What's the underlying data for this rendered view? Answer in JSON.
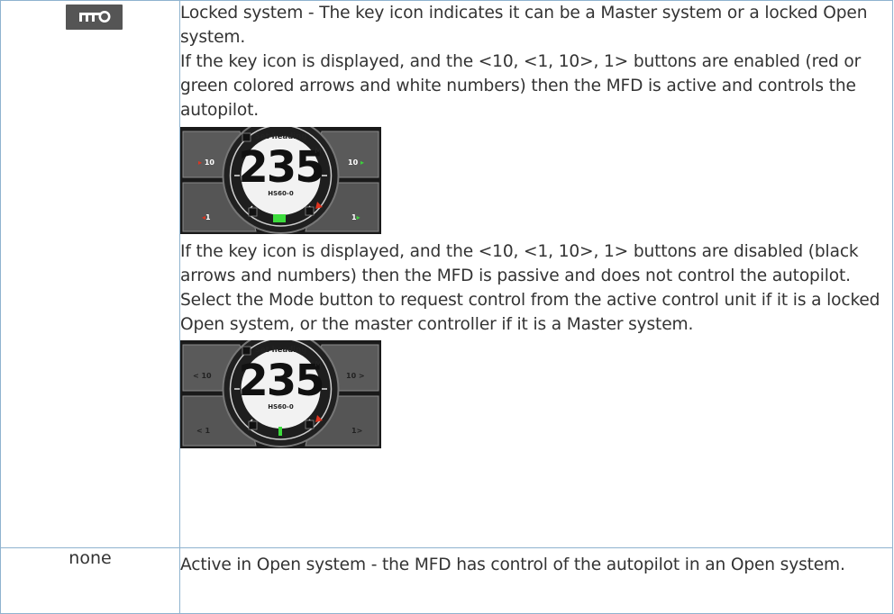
{
  "table": {
    "rows": [
      {
        "icon": "key-icon",
        "paragraphs": [
          "Locked system - The key icon indicates it can be a Master system or a locked Open system.",
          "If the key icon is displayed, and the <10, <1, 10>, 1> buttons are enabled (red or green colored arrows and white numbers) then the MFD is active and controls the autopilot.",
          "If the key icon is displayed, and the <10, <1, 10>, 1> buttons are disabled (black arrows and numbers) then the MFD is passive and does not control the autopilot. Select the Mode button to request control from the active control unit if it is a locked Open system, or the master controller if it is a Master system."
        ]
      },
      {
        "label": "none",
        "paragraphs": [
          "Active in Open system - the MFD has control of the autopilot in an Open system."
        ]
      }
    ]
  },
  "autopilot_active": {
    "title": "Set heading",
    "heading": "235",
    "unit": "°M",
    "mode": "HS60-0",
    "btn_left_top": "10",
    "btn_left_bottom": "1",
    "btn_right_top": "10",
    "btn_right_bottom": "1"
  },
  "autopilot_passive": {
    "title": "Set heading",
    "heading": "235",
    "unit": "°M",
    "mode": "HS60-0",
    "btn_left_top": "< 10",
    "btn_left_bottom": "< 1",
    "btn_right_top": "10 >",
    "btn_right_bottom": "1>"
  },
  "colors": {
    "border": "#8fb3cf",
    "enabled_left_arrow": "#e0341f",
    "enabled_right_arrow": "#3cd23c"
  }
}
